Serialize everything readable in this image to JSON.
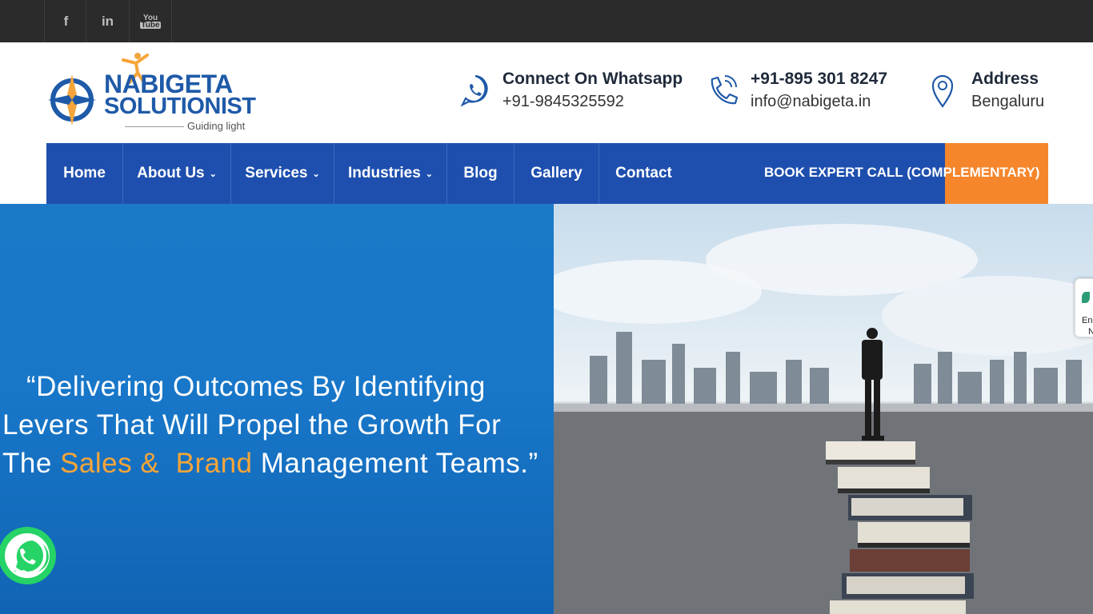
{
  "social": {
    "items": [
      {
        "name": "facebook",
        "glyph": "f"
      },
      {
        "name": "linkedin",
        "glyph": "in"
      },
      {
        "name": "youtube",
        "glyph_top": "You",
        "glyph_bottom": "Tube"
      }
    ]
  },
  "logo": {
    "line1": "NABIGETA",
    "line2": "SOLUTIONIST",
    "tagline": "Guiding light"
  },
  "contacts": [
    {
      "icon": "whatsapp-icon",
      "title": "Connect On Whatsapp",
      "line": "+91-9845325592"
    },
    {
      "icon": "phone-icon",
      "title": "+91-895 301 8247",
      "line": "info@nabigeta.in"
    },
    {
      "icon": "location-pin-icon",
      "title": "Address",
      "line": "Bengaluru"
    }
  ],
  "nav": {
    "items": [
      "Home",
      "About Us",
      "Services",
      "Industries",
      "Blog",
      "Gallery",
      "Contact"
    ],
    "cta": "BOOK EXPERT CALL (COMPLEMENTARY)"
  },
  "hero": {
    "line1": "“Delivering Outcomes By Identifying",
    "line2": "Levers That  Will Propel the Growth For",
    "line3_pre": "The ",
    "line3_hl1": "Sales &",
    "line3_mid": "  ",
    "line3_hl2": "Brand",
    "line3_post": " Management Teams.”"
  },
  "side_widget": {
    "text1": "En",
    "text2": "N"
  },
  "colors": {
    "nav": "#1e4fae",
    "cta": "#f5862b",
    "brand": "#1f5aa8",
    "highlight": "#f5a53a",
    "whatsapp": "#25d366"
  }
}
